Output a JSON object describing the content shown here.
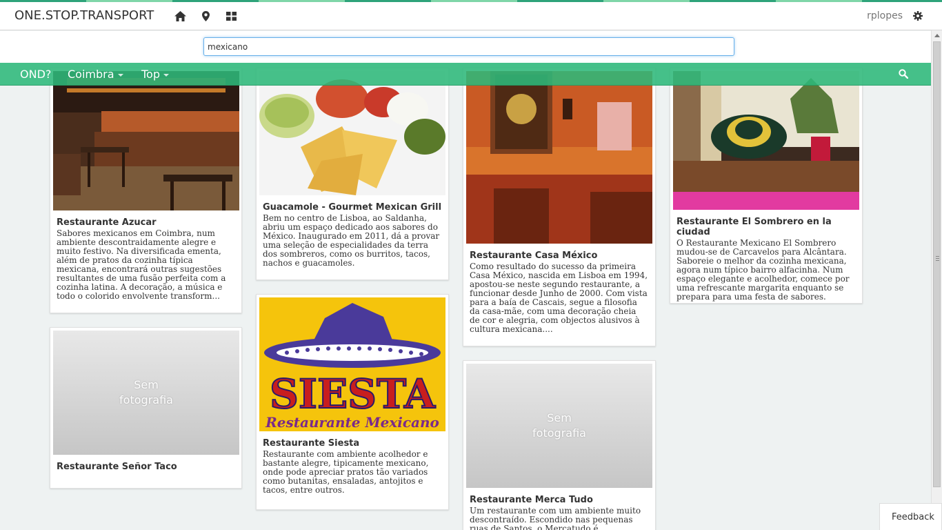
{
  "header": {
    "brand": "ONE.STOP.TRANSPORT",
    "user": "rplopes",
    "icons": [
      "home-icon",
      "map-marker-icon",
      "grid-icon",
      "gear-icon"
    ]
  },
  "search": {
    "value": "mexicano"
  },
  "nav": {
    "items": [
      {
        "label": "OND?"
      },
      {
        "label": "Coimbra"
      },
      {
        "label": "Top"
      }
    ]
  },
  "colors": {
    "accent": "#2eb87a",
    "focus": "#66afe9"
  },
  "no_photo_label": "Sem fotografia",
  "cards": [
    {
      "title": "Restaurante Azucar",
      "desc": "Sabores mexicanos em Coimbra, num ambiente descontraidamente alegre e muito festivo. Na diversificada ementa, além de pratos da cozinha típica mexicana, encontrará outras sugestões resultantes de uma fusão perfeita com a cozinha latina. A decoração, a música e todo o colorido envolvente transform..."
    },
    {
      "title": "Guacamole - Gourmet Mexican Grill",
      "desc": "Bem no centro de Lisboa, ao Saldanha, abriu um espaço dedicado aos sabores do México. Inaugurado em 2011, dá a provar uma seleção de especialidades da terra dos sombreros, como os burritos, tacos, nachos e guacamoles."
    },
    {
      "title": "Restaurante Casa México",
      "desc": "Como resultado do sucesso da primeira Casa México, nascida em Lisboa em 1994, apostou-se neste segundo restaurante, a funcionar desde Junho de 2000. Com vista para a baía de Cascais, segue a filosofia da casa-mãe, com uma decoração cheia de cor e alegria, com objectos alusivos à cultura mexicana...."
    },
    {
      "title": "Restaurante El Sombrero en la ciudad",
      "desc": "O Restaurante Mexicano El Sombrero mudou-se de Carcavelos para Alcântara. Saboreie o melhor da cozinha mexicana, agora num típico bairro alfacinha. Num espaço elegante e acolhedor, comece por uma refrescante margarita enquanto se prepara para uma festa de sabores."
    },
    {
      "title": "Restaurante Señor Taco",
      "desc": ""
    },
    {
      "title": "Restaurante Siesta",
      "desc": "Restaurante com ambiente acolhedor e bastante alegre, tipicamente mexicano, onde pode apreciar pratos tão variados como butanitas, ensaladas, antojitos e tacos, entre outros.",
      "logo_text": "SIESTA",
      "logo_sub": "Restaurante Mexicano"
    },
    {
      "title": "Restaurante Merca Tudo",
      "desc": "Um restaurante com um ambiente muito descontraído. Escondido nas pequenas ruas de Santos, o Mercatudo é"
    }
  ],
  "feedback": "Feedback"
}
